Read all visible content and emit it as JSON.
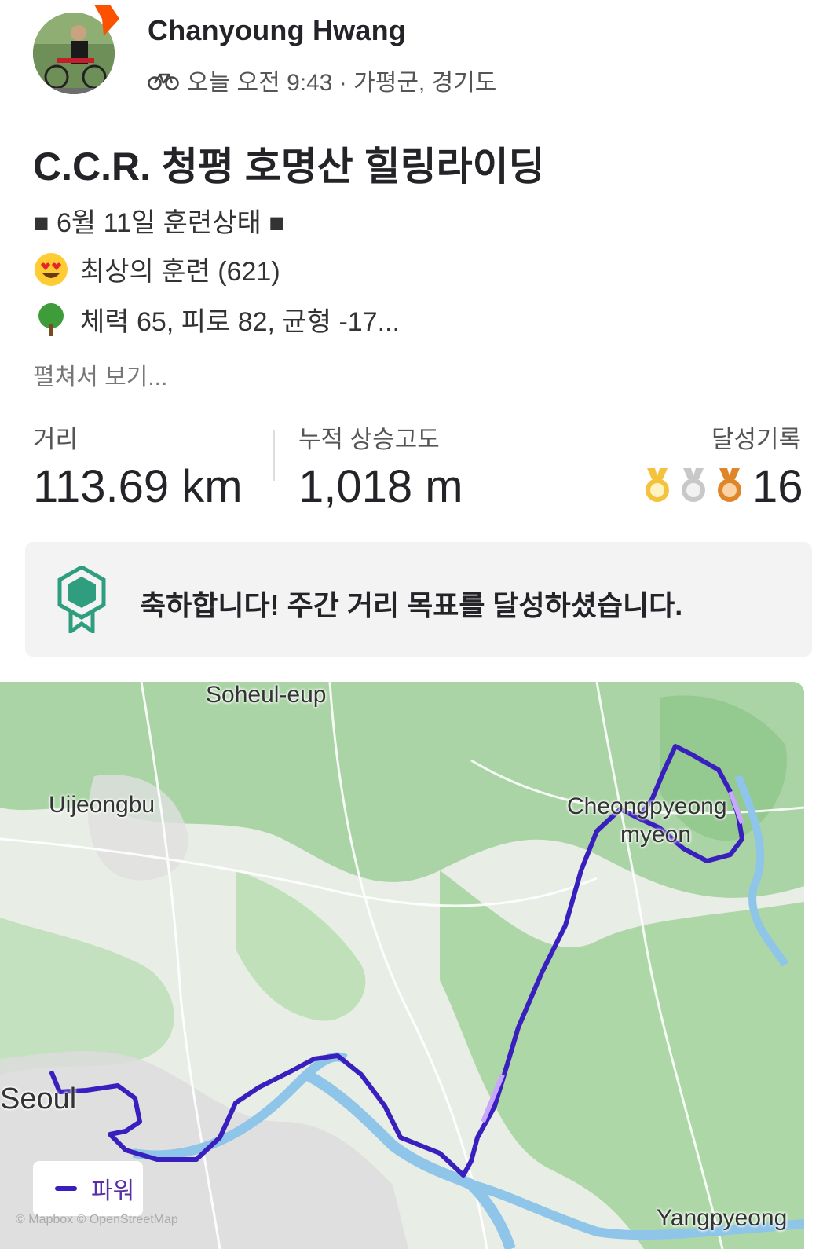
{
  "header": {
    "user_name": "Chanyoung Hwang",
    "activity_icon": "bike-icon",
    "meta": "오늘 오전 9:43 · 가평군, 경기도"
  },
  "activity": {
    "title": "C.C.R. 청평 호명산 힐링라이딩",
    "description_lines": [
      {
        "emoji": "square-icon",
        "text": "■ 6월 11일 훈련상태 ■"
      },
      {
        "emoji": "heart-eyes-emoji",
        "text": "최상의 훈련 (621)"
      },
      {
        "emoji": "tree-emoji",
        "text": "체력 65, 피로 82, 균형 -17..."
      }
    ],
    "expand_label": "펼쳐서 보기..."
  },
  "stats": {
    "distance_label": "거리",
    "distance_value": "113.69 km",
    "elevation_label": "누적 상승고도",
    "elevation_value": "1,018 m",
    "achievements_label": "달성기록",
    "achievements_value": "16"
  },
  "banner": {
    "text": "축하합니다! 주간 거리 목표를 달성하셨습니다."
  },
  "map": {
    "labels": {
      "soheul": "Soheul-eup",
      "uijeongbu": "Uijeongbu",
      "cheongpyeong_1": "Cheongpyeong",
      "cheongpyeong_2": "myeon",
      "seoul": "Seoul",
      "yangpyeong": "Yangpyeong"
    },
    "legend_label": "파워",
    "attribution": "© Mapbox © OpenStreetMap"
  },
  "colors": {
    "route": "#3a1fbf",
    "route_light": "#c9a6ff",
    "accent": "#fc5200",
    "goal_badge": "#2e9e7e"
  }
}
